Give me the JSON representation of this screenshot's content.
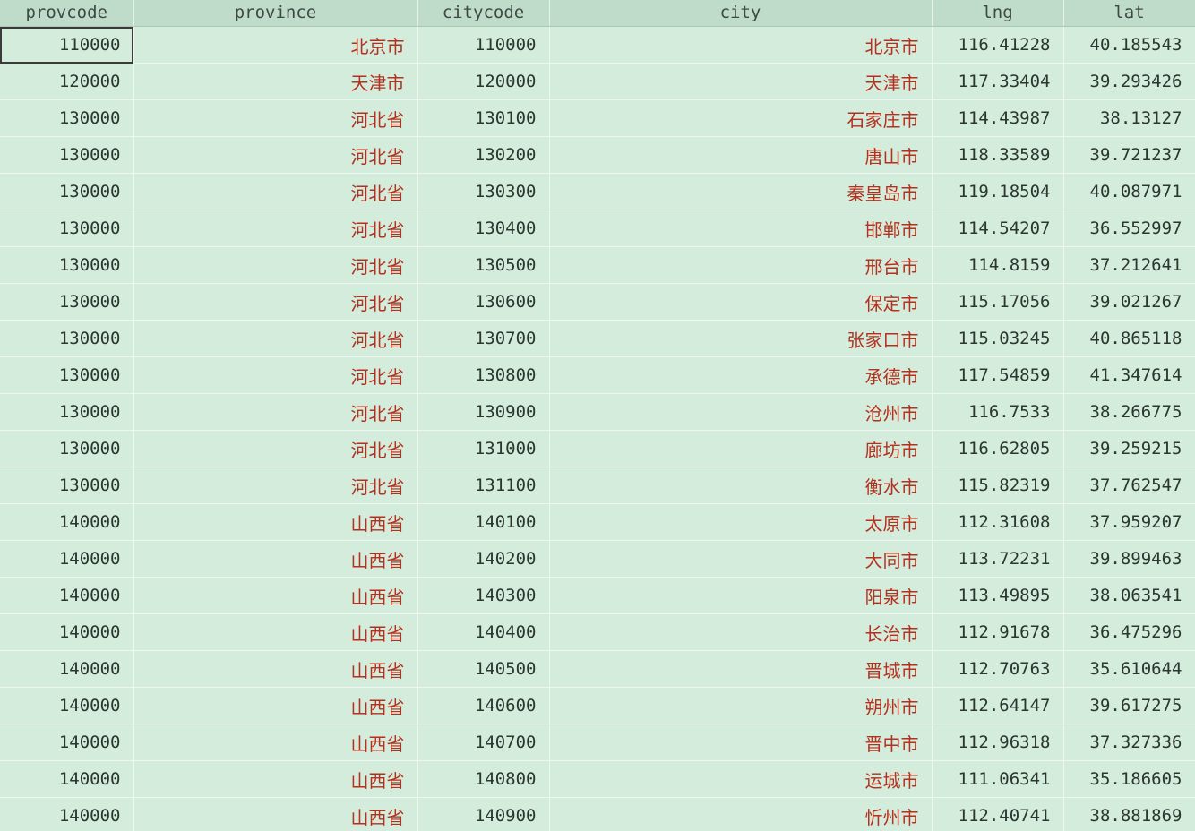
{
  "columns": [
    "provcode",
    "province",
    "citycode",
    "city",
    "lng",
    "lat"
  ],
  "rows": [
    [
      "110000",
      "北京市",
      "110000",
      "北京市",
      "116.41228",
      "40.185543"
    ],
    [
      "120000",
      "天津市",
      "120000",
      "天津市",
      "117.33404",
      "39.293426"
    ],
    [
      "130000",
      "河北省",
      "130100",
      "石家庄市",
      "114.43987",
      "38.13127"
    ],
    [
      "130000",
      "河北省",
      "130200",
      "唐山市",
      "118.33589",
      "39.721237"
    ],
    [
      "130000",
      "河北省",
      "130300",
      "秦皇岛市",
      "119.18504",
      "40.087971"
    ],
    [
      "130000",
      "河北省",
      "130400",
      "邯郸市",
      "114.54207",
      "36.552997"
    ],
    [
      "130000",
      "河北省",
      "130500",
      "邢台市",
      "114.8159",
      "37.212641"
    ],
    [
      "130000",
      "河北省",
      "130600",
      "保定市",
      "115.17056",
      "39.021267"
    ],
    [
      "130000",
      "河北省",
      "130700",
      "张家口市",
      "115.03245",
      "40.865118"
    ],
    [
      "130000",
      "河北省",
      "130800",
      "承德市",
      "117.54859",
      "41.347614"
    ],
    [
      "130000",
      "河北省",
      "130900",
      "沧州市",
      "116.7533",
      "38.266775"
    ],
    [
      "130000",
      "河北省",
      "131000",
      "廊坊市",
      "116.62805",
      "39.259215"
    ],
    [
      "130000",
      "河北省",
      "131100",
      "衡水市",
      "115.82319",
      "37.762547"
    ],
    [
      "140000",
      "山西省",
      "140100",
      "太原市",
      "112.31608",
      "37.959207"
    ],
    [
      "140000",
      "山西省",
      "140200",
      "大同市",
      "113.72231",
      "39.899463"
    ],
    [
      "140000",
      "山西省",
      "140300",
      "阳泉市",
      "113.49895",
      "38.063541"
    ],
    [
      "140000",
      "山西省",
      "140400",
      "长治市",
      "112.91678",
      "36.475296"
    ],
    [
      "140000",
      "山西省",
      "140500",
      "晋城市",
      "112.70763",
      "35.610644"
    ],
    [
      "140000",
      "山西省",
      "140600",
      "朔州市",
      "112.64147",
      "39.617275"
    ],
    [
      "140000",
      "山西省",
      "140700",
      "晋中市",
      "112.96318",
      "37.327336"
    ],
    [
      "140000",
      "山西省",
      "140800",
      "运城市",
      "111.06341",
      "35.186605"
    ],
    [
      "140000",
      "山西省",
      "140900",
      "忻州市",
      "112.40741",
      "38.881869"
    ]
  ],
  "colors": {
    "background": "#d3ecdb",
    "header_bg": "#bfdcca",
    "chinese_text": "#b5301e",
    "number_text": "#2b3630"
  }
}
